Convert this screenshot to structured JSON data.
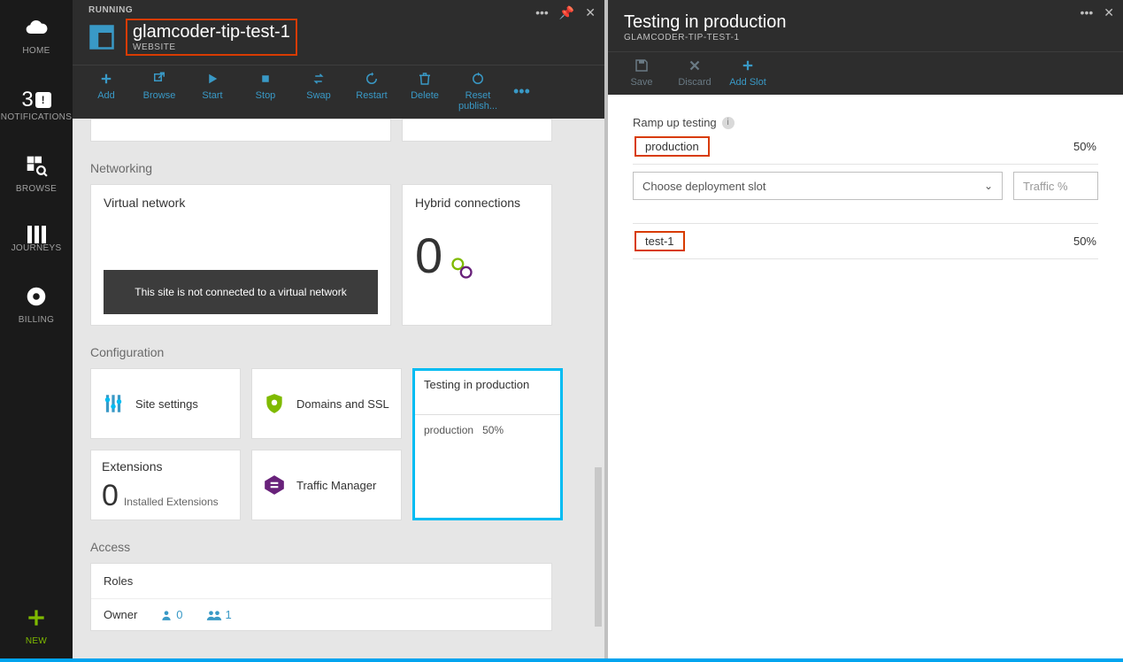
{
  "nav": {
    "home": "HOME",
    "notifications_label": "NOTIFICATIONS",
    "notifications_count": "3",
    "browse": "BROWSE",
    "journeys": "JOURNEYS",
    "billing": "BILLING",
    "new": "NEW"
  },
  "blade1": {
    "status": "RUNNING",
    "title": "glamcoder-tip-test-1",
    "subtitle": "WEBSITE",
    "toolbar": {
      "add": "Add",
      "browse": "Browse",
      "start": "Start",
      "stop": "Stop",
      "swap": "Swap",
      "restart": "Restart",
      "delete": "Delete",
      "reset": "Reset publish..."
    },
    "sections": {
      "networking": "Networking",
      "configuration": "Configuration",
      "access": "Access"
    },
    "vnet": {
      "title": "Virtual network",
      "msg": "This site is not connected to a virtual network"
    },
    "hybrid": {
      "title": "Hybrid connections",
      "count": "0"
    },
    "cfg": {
      "site_settings": "Site settings",
      "domains_ssl": "Domains and SSL",
      "traffic_manager": "Traffic Manager",
      "extensions_title": "Extensions",
      "extensions_count": "0",
      "extensions_sub": "Installed Extensions",
      "tip_title": "Testing in production",
      "tip_line_name": "production",
      "tip_line_pct": "50%"
    },
    "roles": {
      "title": "Roles",
      "owner": "Owner",
      "users_single": "0",
      "users_group": "1"
    }
  },
  "blade2": {
    "title": "Testing in production",
    "subtitle": "GLAMCODER-TIP-TEST-1",
    "toolbar": {
      "save": "Save",
      "discard": "Discard",
      "addslot": "Add Slot"
    },
    "ramp_label": "Ramp up testing",
    "select_placeholder": "Choose deployment slot",
    "traffic_placeholder": "Traffic %",
    "slots": [
      {
        "name": "production",
        "pct": "50%"
      },
      {
        "name": "test-1",
        "pct": "50%"
      }
    ]
  }
}
